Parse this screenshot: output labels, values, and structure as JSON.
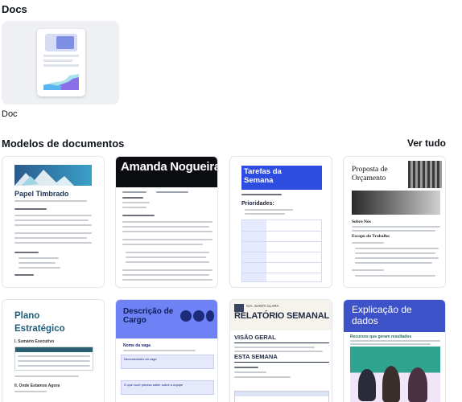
{
  "docs_section": {
    "title": "Docs",
    "tile_label": "Doc"
  },
  "templates_section": {
    "title": "Modelos de documentos",
    "see_all": "Ver tudo",
    "cards": [
      {
        "title": "Papel Timbrado"
      },
      {
        "title": "Amanda Nogueira"
      },
      {
        "title": "Tarefas da Semana",
        "heading": "Prioridades:"
      },
      {
        "title": "Proposta de Orçamento",
        "section1": "Sobre Nós",
        "section2": "Escopo do Trabalho"
      },
      {
        "title": "Plano Estratégico",
        "section1": "I. Sumário Executivo",
        "section2": "II. Onde Estamos Agora"
      },
      {
        "title": "Descrição de Cargo",
        "field1": "Nome da vaga",
        "box1": "Necessidades da vaga",
        "box2": "O que você precisa saber sobre a equipe"
      },
      {
        "badge": "CIA. SANTA CLARA",
        "title": "RELATÓRIO SEMANAL",
        "heading1": "VISÃO GERAL",
        "heading2": "ESTA SEMANA"
      },
      {
        "title": "Explicação de dados",
        "subtitle": "Recursos que geram resultados"
      }
    ]
  },
  "colors": {
    "page_bg": "#ffffff",
    "tile_bg": "#eef0f3",
    "card_border": "#e3e6ea"
  }
}
